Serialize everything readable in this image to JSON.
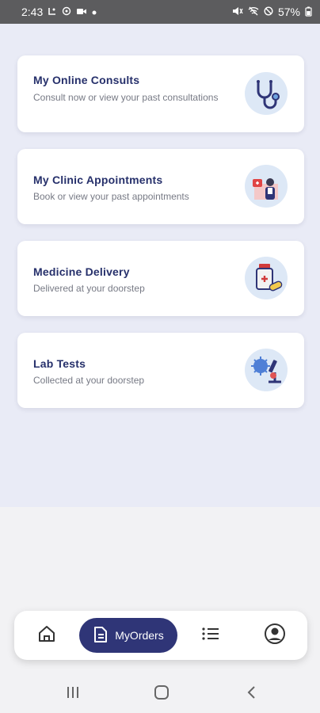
{
  "status_bar": {
    "time": "2:43",
    "battery": "57%",
    "left_icons": [
      "screenshot-icon",
      "shield-icon",
      "video-icon",
      "dot-icon"
    ],
    "right_icons": [
      "mute-icon",
      "wifi-icon",
      "dnd-icon",
      "battery-icon"
    ]
  },
  "cards": [
    {
      "title": "My Online Consults",
      "subtitle": "Consult now or view your past consultations",
      "icon": "stethoscope-icon"
    },
    {
      "title": "My Clinic Appointments",
      "subtitle": "Book or view your past appointments",
      "icon": "clinic-icon"
    },
    {
      "title": "Medicine Delivery",
      "subtitle": "Delivered at your doorstep",
      "icon": "medicine-icon"
    },
    {
      "title": "Lab Tests",
      "subtitle": "Collected at your doorstep",
      "icon": "microscope-icon"
    }
  ],
  "bottom_nav": {
    "active_label": "MyOrders",
    "items": [
      "home-icon",
      "orders-icon",
      "list-icon",
      "profile-icon"
    ]
  },
  "system_nav": [
    "recents-icon",
    "home-circle-icon",
    "back-icon"
  ],
  "colors": {
    "accent": "#2f3577",
    "title": "#26306b",
    "content_bg": "#e9ebf6",
    "icon_bg": "#dde8f6"
  }
}
